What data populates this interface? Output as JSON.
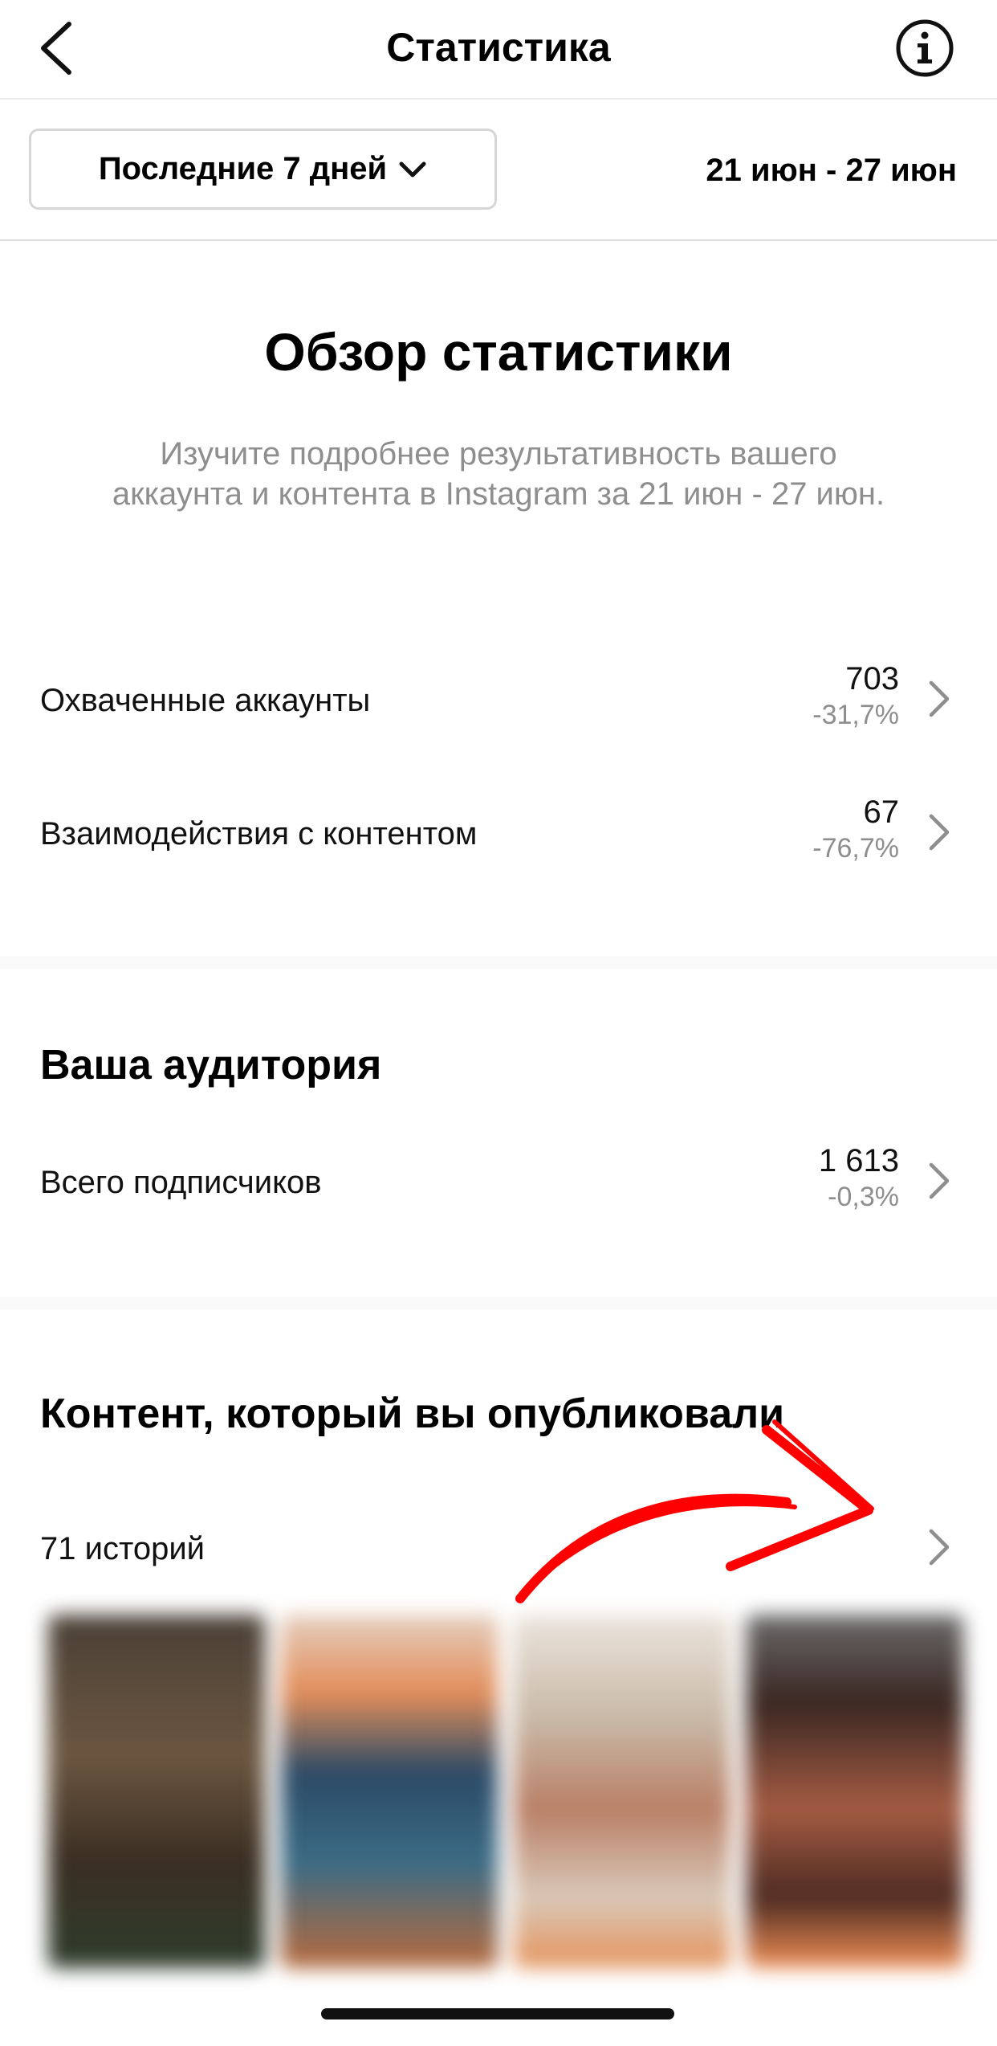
{
  "header": {
    "title": "Статистика",
    "back_icon": "chevron-left-icon",
    "info_icon": "info-icon"
  },
  "filter": {
    "range_label": "Последние 7 дней",
    "date_range": "21 июн - 27 июн"
  },
  "overview": {
    "title": "Обзор статистики",
    "subtitle": "Изучите подробнее результативность вашего аккаунта и контента в Instagram за 21 июн - 27 июн."
  },
  "metrics": [
    {
      "label": "Охваченные аккаунты",
      "value": "703",
      "delta": "-31,7%"
    },
    {
      "label": "Взаимодействия с контентом",
      "value": "67",
      "delta": "-76,7%"
    }
  ],
  "audience": {
    "title": "Ваша аудитория",
    "label": "Всего подписчиков",
    "value": "1 613",
    "delta": "-0,3%"
  },
  "content": {
    "title": "Контент, который вы опубликовали",
    "stories_label": "71 историй",
    "thumbnail_count": 4
  },
  "colors": {
    "annotation_arrow": "#ff0000",
    "muted_text": "#8e8e8e"
  }
}
